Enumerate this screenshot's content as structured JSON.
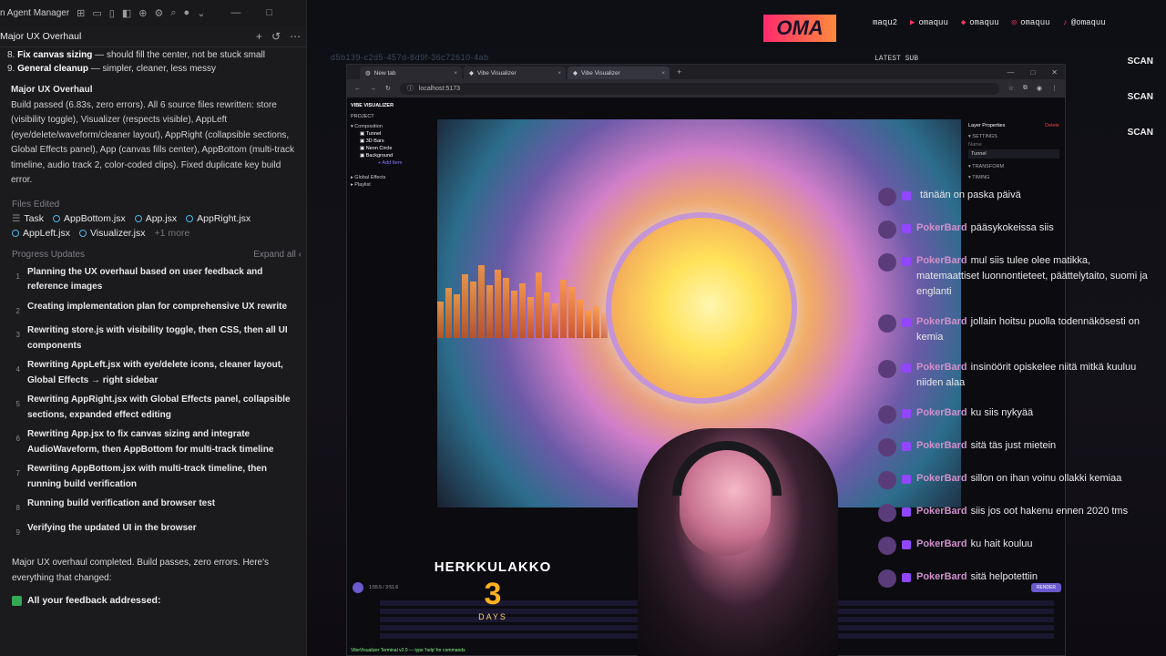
{
  "agent": {
    "window_title": "n Agent Manager",
    "conversation_title": "Major UX Overhaul",
    "plan_items": [
      {
        "num": "8.",
        "bold": "Fix canvas sizing",
        "rest": " — should fill the center, not be stuck small"
      },
      {
        "num": "9.",
        "bold": "General cleanup",
        "rest": " — simpler, cleaner, less messy"
      }
    ],
    "summary": {
      "heading": "Major UX Overhaul",
      "body": "Build passed (6.83s, zero errors). All 6 source files rewritten: store (visibility toggle), Visualizer (respects visible), AppLeft (eye/delete/waveform/cleaner layout), AppRight (collapsible sections, Global Effects panel), App (canvas fills center), AppBottom (multi-track timeline, audio track 2, color-coded clips). Fixed duplicate key build error."
    },
    "files_label": "Files Edited",
    "files": [
      "Task",
      "AppBottom.jsx",
      "App.jsx",
      "AppRight.jsx",
      "AppLeft.jsx",
      "Visualizer.jsx"
    ],
    "files_more": "+1 more",
    "progress_label": "Progress Updates",
    "expand_all": "Expand all",
    "steps": [
      {
        "n": "1",
        "text": "Planning the UX overhaul based on user feedback and reference images"
      },
      {
        "n": "2",
        "text": "Creating implementation plan for comprehensive UX rewrite"
      },
      {
        "n": "3",
        "text": "Rewriting store.js with visibility toggle, then CSS, then all UI components"
      },
      {
        "n": "4",
        "text": "Rewriting AppLeft.jsx with eye/delete icons, cleaner layout, Global Effects → right sidebar"
      },
      {
        "n": "5",
        "text": "Rewriting AppRight.jsx with Global Effects panel, collapsible sections, expanded effect editing"
      },
      {
        "n": "6",
        "text": "Rewriting App.jsx to fix canvas sizing and integrate AudioWaveform, then AppBottom for multi-track timeline"
      },
      {
        "n": "7",
        "text": "Rewriting AppBottom.jsx with multi-track timeline, then running build verification"
      },
      {
        "n": "8",
        "text": "Running build verification and browser test"
      },
      {
        "n": "9",
        "text": "Verifying the updated UI in the browser"
      }
    ],
    "done_text": "Major UX overhaul completed. Build passes, zero errors. Here's everything that changed:",
    "check_text": "All your feedback addressed:"
  },
  "bg_url": "d5b139-c2d5-457d-8d9f-36c72610-4ab",
  "browser": {
    "tabs": [
      "New tab",
      "Vibe Visualizer",
      "Vibe Visualizer"
    ],
    "url": "localhost:5173"
  },
  "app": {
    "title": "VIBE VISUALIZER",
    "project": "PROJECT",
    "composition": "Composition",
    "layers": [
      "Tunnel",
      "3D Bars",
      "Neon Circle",
      "Background"
    ],
    "add_item": "+ Add Item",
    "global_effects": "Global Effects",
    "playlist": "Playlist",
    "props_title": "Layer Properties",
    "props_delete": "Delete",
    "settings": "SETTINGS",
    "name_label": "Name",
    "name_value": "Tunnel",
    "transform": "TRANSFORM",
    "timing": "TIMING",
    "time": "1:55.5 / 3:51.6",
    "render": "RENDER",
    "terminal": "VibeVisualizer Terminal v2.0 — type 'help' for commands"
  },
  "overlay": {
    "logo": "OMA",
    "handles": [
      "maqu2",
      "omaquu",
      "omaquu",
      "omaquu",
      "@omaquu"
    ],
    "latest_sub": "LATEST SUB",
    "scan_labels": [
      "SCAN",
      "SCAN",
      "SCAN"
    ],
    "countdown_title": "HERKKULAKKO",
    "countdown_num": "3",
    "countdown_unit": "DAYS"
  },
  "chat": [
    {
      "user": "",
      "text": "tänään on paska päivä"
    },
    {
      "user": "PokerBard",
      "text": "pääsykokeissa siis"
    },
    {
      "user": "PokerBard",
      "text": "mul siis tulee olee matikka, matemaattiset luonnontieteet, päättelytaito, suomi ja englanti"
    },
    {
      "user": "PokerBard",
      "text": "jollain hoitsu puolla todennäkösesti on kemia"
    },
    {
      "user": "PokerBard",
      "text": "insinöörit opiskelee niitä mitkä kuuluu niiden alaa"
    },
    {
      "user": "PokerBard",
      "text": "ku siis nykyää"
    },
    {
      "user": "PokerBard",
      "text": "sitä täs just mietein"
    },
    {
      "user": "PokerBard",
      "text": "sillon on ihan voinu ollakki kemiaa"
    },
    {
      "user": "PokerBard",
      "text": "siis jos oot hakenu ennen 2020 tms"
    },
    {
      "user": "PokerBard",
      "text": "ku hait kouluu"
    },
    {
      "user": "PokerBard",
      "text": "sitä helpotettiin"
    }
  ]
}
